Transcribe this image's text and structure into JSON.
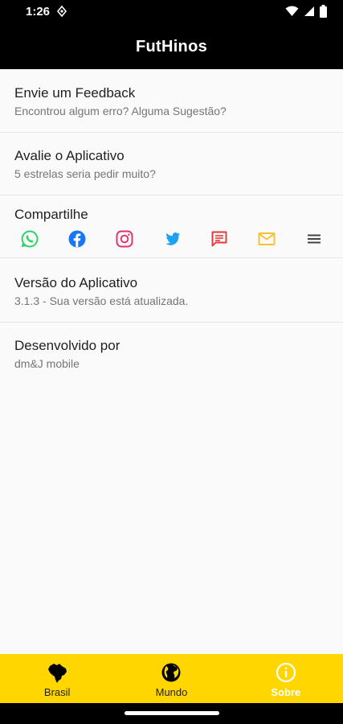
{
  "status_bar": {
    "time": "1:26"
  },
  "app_bar": {
    "title": "FutHinos"
  },
  "rows": {
    "feedback": {
      "title": "Envie um Feedback",
      "subtitle": "Encontrou algum erro? Alguma Sugestão?"
    },
    "rate": {
      "title": "Avalie o Aplicativo",
      "subtitle": "5 estrelas seria pedir muito?"
    },
    "share": {
      "title": "Compartilhe",
      "icons": [
        "whatsapp-icon",
        "facebook-icon",
        "instagram-icon",
        "twitter-icon",
        "sms-icon",
        "email-icon",
        "more-menu-icon"
      ]
    },
    "version": {
      "title": "Versão do Aplicativo",
      "subtitle": "3.1.3 - Sua versão está atualizada."
    },
    "developer": {
      "title": "Desenvolvido por",
      "subtitle": "dm&J mobile"
    }
  },
  "bottom_nav": {
    "items": [
      {
        "label": "Brasil",
        "icon": "brazil-map-icon",
        "active": false
      },
      {
        "label": "Mundo",
        "icon": "globe-icon",
        "active": false
      },
      {
        "label": "Sobre",
        "icon": "info-icon",
        "active": true
      }
    ]
  },
  "colors": {
    "accent": "#ffd600",
    "app_bar": "#000000",
    "whatsapp": "#25d366",
    "facebook": "#1877f2",
    "instagram": "#e1306c",
    "twitter": "#1da1f2",
    "sms": "#e53935",
    "email": "#fbc02d"
  }
}
